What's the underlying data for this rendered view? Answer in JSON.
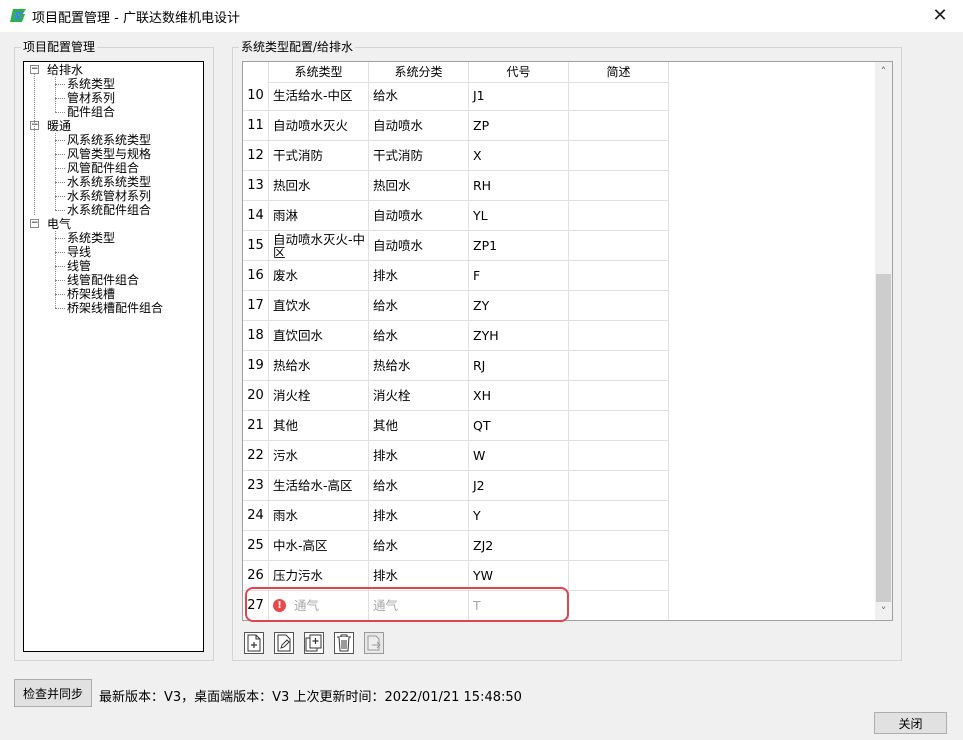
{
  "window": {
    "title": "项目配置管理 - 广联达数维机电设计",
    "close_glyph": "✕"
  },
  "left_panel": {
    "group_title": "项目配置管理",
    "tree": [
      {
        "label": "给排水",
        "toggle": "−",
        "children": [
          "系统类型",
          "管材系列",
          "配件组合"
        ]
      },
      {
        "label": "暖通",
        "toggle": "−",
        "children": [
          "风系统系统类型",
          "风管类型与规格",
          "风管配件组合",
          "水系统系统类型",
          "水系统管材系列",
          "水系统配件组合"
        ]
      },
      {
        "label": "电气",
        "toggle": "−",
        "children": [
          "系统类型",
          "导线",
          "线管",
          "线管配件组合",
          "桥架线槽",
          "桥架线槽配件组合"
        ]
      }
    ]
  },
  "right_panel": {
    "group_title": "系统类型配置/给排水",
    "columns": [
      "系统类型",
      "系统分类",
      "代号",
      "简述"
    ],
    "rows": [
      {
        "num": "10",
        "type": "生活给水-中区",
        "category": "给水",
        "code": "J1",
        "desc": ""
      },
      {
        "num": "11",
        "type": "自动喷水灭火",
        "category": "自动喷水",
        "code": "ZP",
        "desc": ""
      },
      {
        "num": "12",
        "type": "干式消防",
        "category": "干式消防",
        "code": "X",
        "desc": ""
      },
      {
        "num": "13",
        "type": "热回水",
        "category": "热回水",
        "code": "RH",
        "desc": ""
      },
      {
        "num": "14",
        "type": "雨淋",
        "category": "自动喷水",
        "code": "YL",
        "desc": ""
      },
      {
        "num": "15",
        "type": "自动喷水灭火-中区",
        "category": "自动喷水",
        "code": "ZP1",
        "desc": ""
      },
      {
        "num": "16",
        "type": "废水",
        "category": "排水",
        "code": "F",
        "desc": ""
      },
      {
        "num": "17",
        "type": "直饮水",
        "category": "给水",
        "code": "ZY",
        "desc": ""
      },
      {
        "num": "18",
        "type": "直饮回水",
        "category": "给水",
        "code": "ZYH",
        "desc": ""
      },
      {
        "num": "19",
        "type": "热给水",
        "category": "热给水",
        "code": "RJ",
        "desc": ""
      },
      {
        "num": "20",
        "type": "消火栓",
        "category": "消火栓",
        "code": "XH",
        "desc": ""
      },
      {
        "num": "21",
        "type": "其他",
        "category": "其他",
        "code": "QT",
        "desc": ""
      },
      {
        "num": "22",
        "type": "污水",
        "category": "排水",
        "code": "W",
        "desc": ""
      },
      {
        "num": "23",
        "type": "生活给水-高区",
        "category": "给水",
        "code": "J2",
        "desc": ""
      },
      {
        "num": "24",
        "type": "雨水",
        "category": "排水",
        "code": "Y",
        "desc": ""
      },
      {
        "num": "25",
        "type": "中水-高区",
        "category": "给水",
        "code": "ZJ2",
        "desc": ""
      },
      {
        "num": "26",
        "type": "压力污水",
        "category": "排水",
        "code": "YW",
        "desc": ""
      },
      {
        "num": "27",
        "type": "通气",
        "category": "通气",
        "code": "T",
        "desc": "",
        "warning": "!"
      }
    ],
    "scroll_up": "˄",
    "scroll_down": "˅",
    "toolbar": [
      "add-icon",
      "edit-icon",
      "duplicate-icon",
      "delete-icon",
      "export-icon"
    ]
  },
  "footer": {
    "sync_button": "检查并同步",
    "status": "最新版本：V3，桌面端版本：V3 上次更新时间：2022/01/21 15:48:50",
    "close_button": "关闭"
  },
  "colors": {
    "highlight": "#e0454e",
    "warning": "#e8484a",
    "logo_green": "#2bb24c",
    "logo_blue": "#1e6fd9"
  }
}
